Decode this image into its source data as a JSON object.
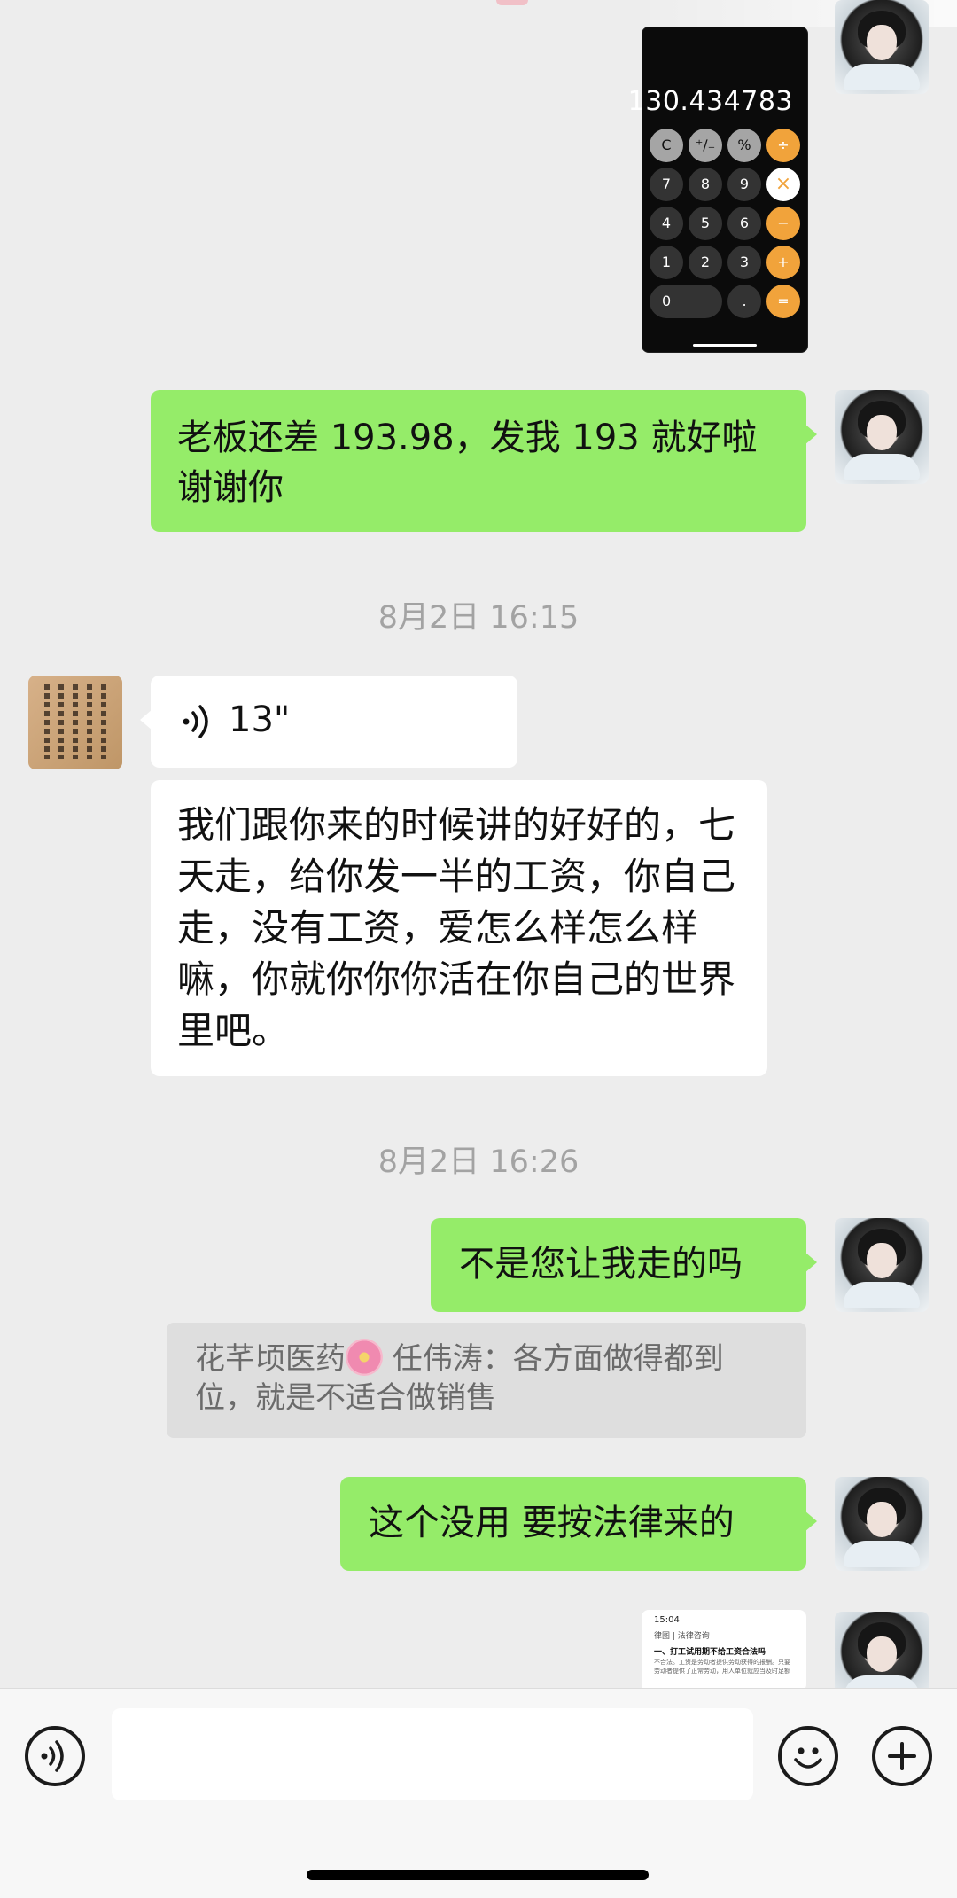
{
  "calculator": {
    "display": "130.434783",
    "keys": [
      "C",
      "⁺∕₋",
      "%",
      "÷",
      "7",
      "8",
      "9",
      "×",
      "4",
      "5",
      "6",
      "−",
      "1",
      "2",
      "3",
      "+",
      "0",
      ".",
      "="
    ]
  },
  "messages": {
    "m1": "老板还差 193.98，发我 193 就好啦谢谢你",
    "time1": "8月2日 16:15",
    "voice_duration": "13\"",
    "transcript": "我们跟你来的时候讲的好好的，七天走，给你发一半的工资，你自己走，没有工资，爱怎么样怎么样嘛，你就你你你活在你自己的世界里吧。",
    "time2": "8月2日 16:26",
    "m2": "不是您让我走的吗",
    "quote_prefix": "花芊顷医药",
    "quote_rest": " 任伟涛：各方面做得都到位，就是不适合做销售",
    "m3": "这个没用 要按法律来的"
  },
  "doc_preview": {
    "time": "15:04",
    "header": "律图 | 法律咨询",
    "heading": "一、打工试用期不给工资合法吗",
    "body": "不合法。工资是劳动者提供劳动获得的报酬。只要劳动者提供了正常劳动，用人单位就应当及时足额"
  },
  "colors": {
    "bg": "#ededed",
    "my_bubble": "#95ec69",
    "their_bubble": "#ffffff"
  },
  "icons": [
    "voice-input-icon",
    "emoji-icon",
    "plus-icon",
    "voice-wave-icon"
  ]
}
